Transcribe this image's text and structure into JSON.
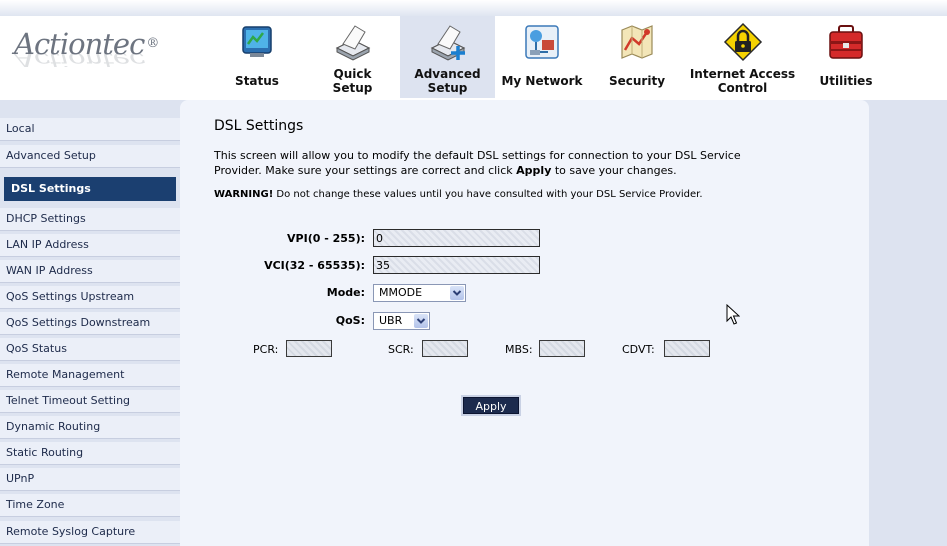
{
  "brand": {
    "name": "Actiontec",
    "reg_mark": "®"
  },
  "nav": {
    "tabs": [
      {
        "id": "status",
        "lines": [
          "Status"
        ],
        "icon": "status-monitor-icon"
      },
      {
        "id": "quick-setup",
        "lines": [
          "Quick",
          "Setup"
        ],
        "icon": "scanner-icon"
      },
      {
        "id": "advanced-setup",
        "lines": [
          "Advanced",
          "Setup"
        ],
        "icon": "scanner-plus-icon",
        "active": true
      },
      {
        "id": "my-network",
        "lines": [
          "My Network"
        ],
        "icon": "network-map-icon"
      },
      {
        "id": "security",
        "lines": [
          "Security"
        ],
        "icon": "security-map-icon"
      },
      {
        "id": "internet-access-control",
        "lines": [
          "Internet Access",
          "Control"
        ],
        "icon": "padlock-icon"
      },
      {
        "id": "utilities",
        "lines": [
          "Utilities"
        ],
        "icon": "toolbox-icon"
      }
    ]
  },
  "sidebar": {
    "items": [
      {
        "label": "Local"
      },
      {
        "label": "Advanced Setup"
      },
      {
        "label": "DSL Settings",
        "active": true
      },
      {
        "label": "DHCP Settings"
      },
      {
        "label": "LAN IP Address"
      },
      {
        "label": "WAN IP Address"
      },
      {
        "label": "QoS Settings Upstream"
      },
      {
        "label": "QoS Settings Downstream"
      },
      {
        "label": "QoS Status"
      },
      {
        "label": "Remote Management"
      },
      {
        "label": "Telnet Timeout Setting"
      },
      {
        "label": "Dynamic Routing"
      },
      {
        "label": "Static Routing"
      },
      {
        "label": "UPnP"
      },
      {
        "label": "Time Zone"
      },
      {
        "label": "Remote Syslog Capture"
      }
    ]
  },
  "main": {
    "title": "DSL Settings",
    "intro_part1": "This screen will allow you to modify the default DSL settings for connection to your DSL Service Provider. Make sure your settings are correct and click ",
    "intro_bold": "Apply",
    "intro_part2": " to save your changes.",
    "warning_bold": "WARNING!",
    "warning_text": " Do not change these values until you have consulted with your DSL Service Provider.",
    "form": {
      "vpi_label": "VPI(0 - 255):",
      "vpi_value": "0",
      "vci_label": "VCI(32 - 65535):",
      "vci_value": "35",
      "mode_label": "Mode:",
      "mode_value": "MMODE",
      "qos_label": "QoS:",
      "qos_value": "UBR",
      "pcr_label": "PCR:",
      "scr_label": "SCR:",
      "mbs_label": "MBS:",
      "cdvt_label": "CDVT:"
    },
    "apply_label": "Apply"
  },
  "colors": {
    "page_bg": "#dde3f0",
    "content_bg": "#f1f4fb",
    "sidebar_item_bg": "#ebeff8",
    "sidebar_active_bg": "#1b3f70",
    "apply_button_bg": "#1c2a4d",
    "active_tab_bg": "#dde3f0"
  }
}
